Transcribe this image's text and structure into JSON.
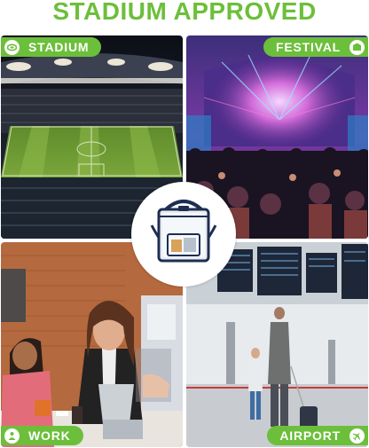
{
  "title": "STADIUM APPROVED",
  "panels": {
    "stadium": {
      "label": "STADIUM",
      "icon": "stadium-icon"
    },
    "festival": {
      "label": "FESTIVAL",
      "icon": "festival-icon"
    },
    "work": {
      "label": "WORK",
      "icon": "work-icon"
    },
    "airport": {
      "label": "AIRPORT",
      "icon": "airplane-icon"
    }
  },
  "colors": {
    "accent": "#6cbf3a",
    "badge_text": "#ffffff",
    "bag_trim": "#1f2d52"
  }
}
